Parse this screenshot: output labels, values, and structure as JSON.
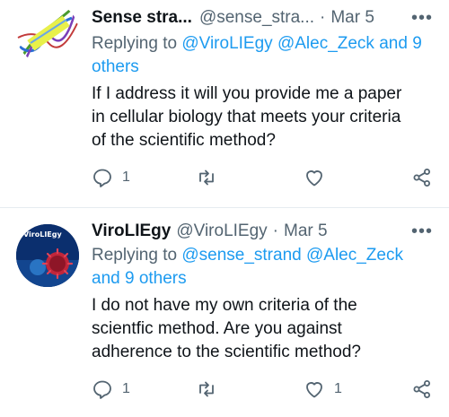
{
  "tweets": [
    {
      "name": "Sense stra...",
      "handle": "@sense_stra...",
      "separator": "·",
      "date": "Mar 5",
      "more": "•••",
      "replying_prefix": "Replying to ",
      "replying_links": "@ViroLIEgy @Alec_Zeck",
      "replying_and": " and 9",
      "replying_rest": "others",
      "text_lines": [
        "If I address it will you provide me a paper",
        "in cellular biology that meets your criteria",
        "of the scientific method?"
      ],
      "reply_count": "1",
      "retweet_count": "",
      "like_count": "",
      "avatar_icon": "rainbow-dna-icon"
    },
    {
      "name": "ViroLIEgy",
      "handle": "@ViroLIEgy",
      "separator": "·",
      "date": "Mar 5",
      "more": "•••",
      "replying_prefix": "Replying to ",
      "replying_links": "@sense_strand @Alec_Zeck",
      "replying_rest": "and 9 others",
      "text_lines": [
        "I do not have my own criteria of the",
        "scientfic method. Are you against",
        "adherence to the scientific method?"
      ],
      "reply_count": "1",
      "retweet_count": "",
      "like_count": "1",
      "avatar_label": "ViroLIEgy",
      "avatar_icon": "virus-icon"
    }
  ],
  "colors": {
    "link": "#1d9bf0",
    "secondary": "#536471",
    "primary": "#0f1419",
    "divider": "#e6ecf0"
  }
}
